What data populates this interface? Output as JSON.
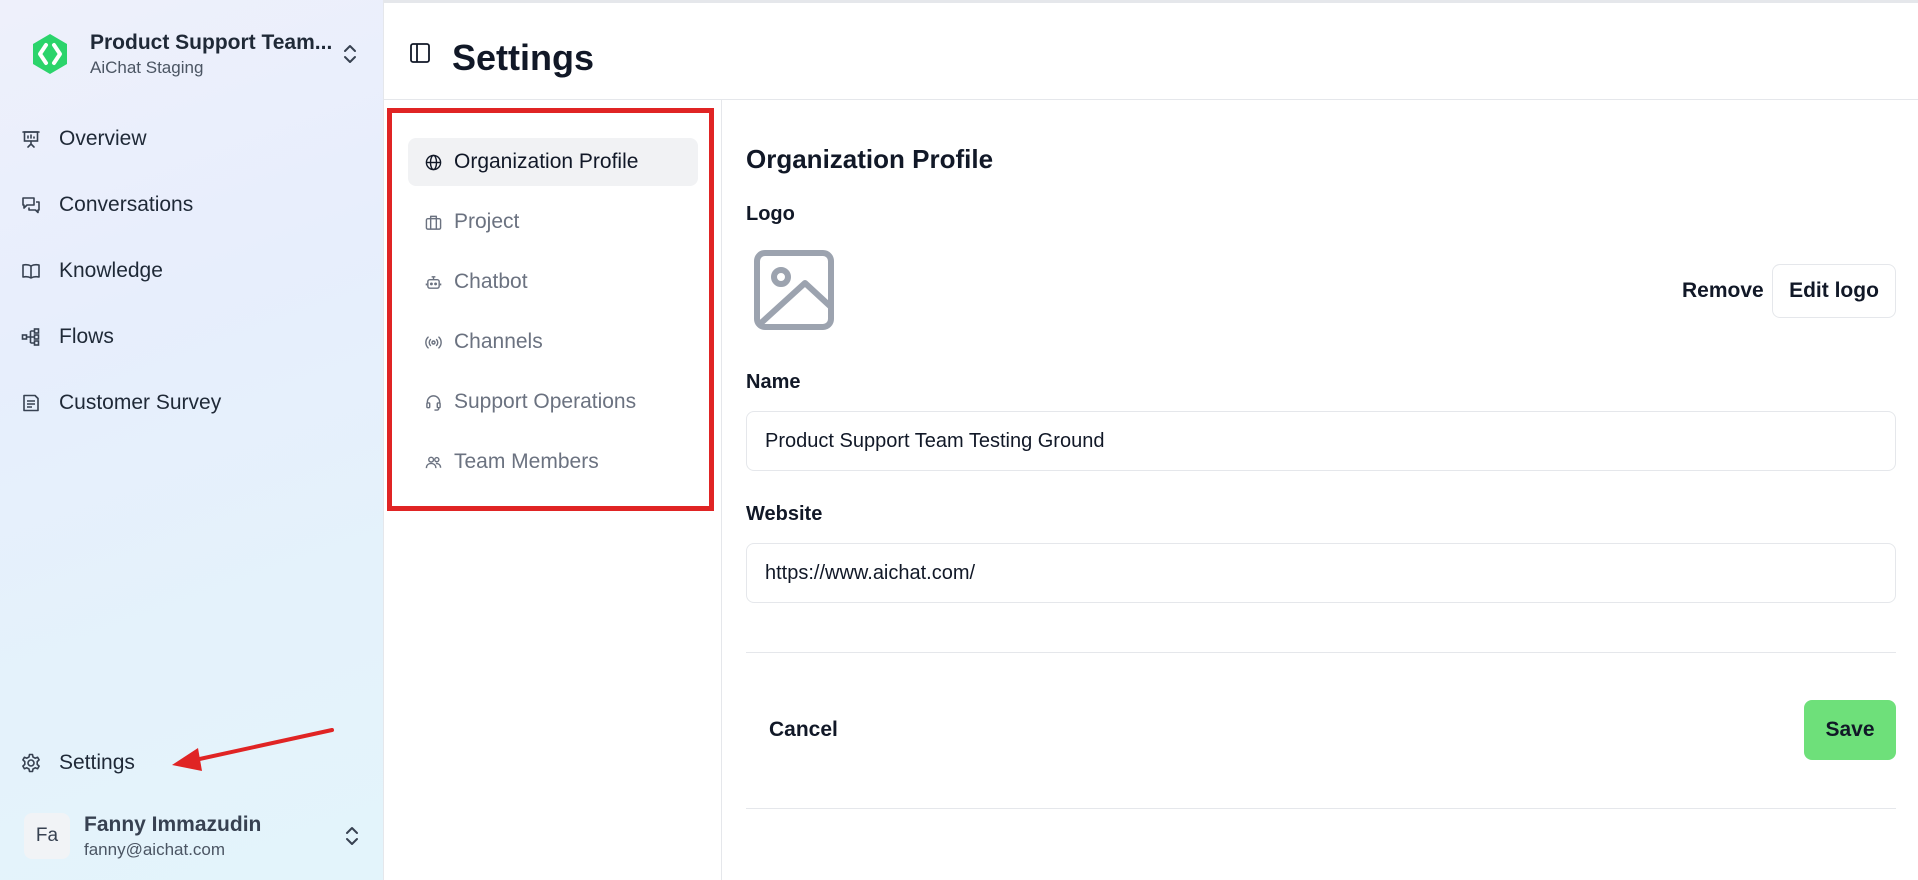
{
  "colors": {
    "accent": "#2bd46b",
    "save_button": "#6ee07a",
    "annotation": "#e02424"
  },
  "sidebar": {
    "org": {
      "name": "Product Support Team...",
      "environment": "AiChat Staging",
      "logo_icon": "aichat-logo-icon",
      "switch_icon": "chevrons-up-down-icon"
    },
    "items": [
      {
        "label": "Overview",
        "icon": "presentation-icon"
      },
      {
        "label": "Conversations",
        "icon": "messages-icon"
      },
      {
        "label": "Knowledge",
        "icon": "book-open-icon"
      },
      {
        "label": "Flows",
        "icon": "flow-icon"
      },
      {
        "label": "Customer Survey",
        "icon": "survey-icon"
      }
    ],
    "settings": {
      "label": "Settings",
      "icon": "gear-icon"
    },
    "user": {
      "initials": "Fa",
      "name": "Fanny Immazudin",
      "email": "fanny@aichat.com",
      "switch_icon": "chevrons-up-down-icon"
    }
  },
  "header": {
    "title": "Settings",
    "toggle_icon": "sidebar-toggle-icon"
  },
  "settings_nav": {
    "items": [
      {
        "label": "Organization Profile",
        "icon": "globe-icon",
        "active": true
      },
      {
        "label": "Project",
        "icon": "briefcase-icon",
        "active": false
      },
      {
        "label": "Chatbot",
        "icon": "bot-icon",
        "active": false
      },
      {
        "label": "Channels",
        "icon": "radio-icon",
        "active": false
      },
      {
        "label": "Support Operations",
        "icon": "headset-icon",
        "active": false
      },
      {
        "label": "Team Members",
        "icon": "users-icon",
        "active": false
      }
    ]
  },
  "form": {
    "section_title": "Organization Profile",
    "logo_label": "Logo",
    "logo_placeholder_icon": "image-placeholder-icon",
    "remove_label": "Remove",
    "edit_logo_label": "Edit logo",
    "name_label": "Name",
    "name_value": "Product Support Team Testing Ground",
    "website_label": "Website",
    "website_value": "https://www.aichat.com/",
    "cancel_label": "Cancel",
    "save_label": "Save"
  }
}
